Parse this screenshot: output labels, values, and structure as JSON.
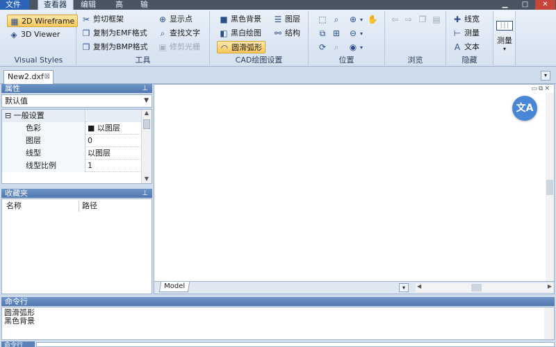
{
  "menubar": {
    "tabs": [
      "文件",
      "查看器",
      "编辑器",
      "高级",
      "输出"
    ]
  },
  "ribbon": {
    "visual_styles": {
      "label": "Visual Styles",
      "buttons": [
        "2D Wireframe",
        "3D Viewer"
      ]
    },
    "tools": {
      "label": "工具",
      "buttons": [
        "剪切框架",
        "复制为EMF格式",
        "复制为BMP格式",
        "显示点",
        "查找文字",
        "修剪光栅"
      ]
    },
    "cad_settings": {
      "label": "CAD绘图设置",
      "buttons": [
        "黑色背景",
        "黑白绘图",
        "圆滑弧形",
        "图层",
        "结构"
      ]
    },
    "position": {
      "label": "位置"
    },
    "browse": {
      "label": "浏览"
    },
    "hide": {
      "label": "隐藏",
      "buttons": [
        "线宽",
        "测量",
        "文本"
      ]
    },
    "measure": {
      "label": "测量"
    }
  },
  "document_tab": {
    "label": "New2.dxf"
  },
  "properties_panel": {
    "title": "属性",
    "selector": "默认值",
    "category": "一般设置",
    "rows": [
      {
        "name": "色彩",
        "value": "■ 以图层"
      },
      {
        "name": "图层",
        "value": "0"
      },
      {
        "name": "线型",
        "value": "以图层"
      },
      {
        "name": "线型比例",
        "value": "1"
      }
    ]
  },
  "favorites_panel": {
    "title": "收藏夹",
    "columns": [
      "名称",
      "路径"
    ]
  },
  "canvas": {
    "layout_tab": "Model",
    "translate_icon": "translate-icon"
  },
  "command": {
    "title": "命令行",
    "log": [
      "圆滑弧形",
      "黑色背景"
    ],
    "input_label": "命令行"
  },
  "colors": {
    "accent": "#2b63b8",
    "panel_title": "#5a82b8",
    "selected": "#f6c85f"
  }
}
